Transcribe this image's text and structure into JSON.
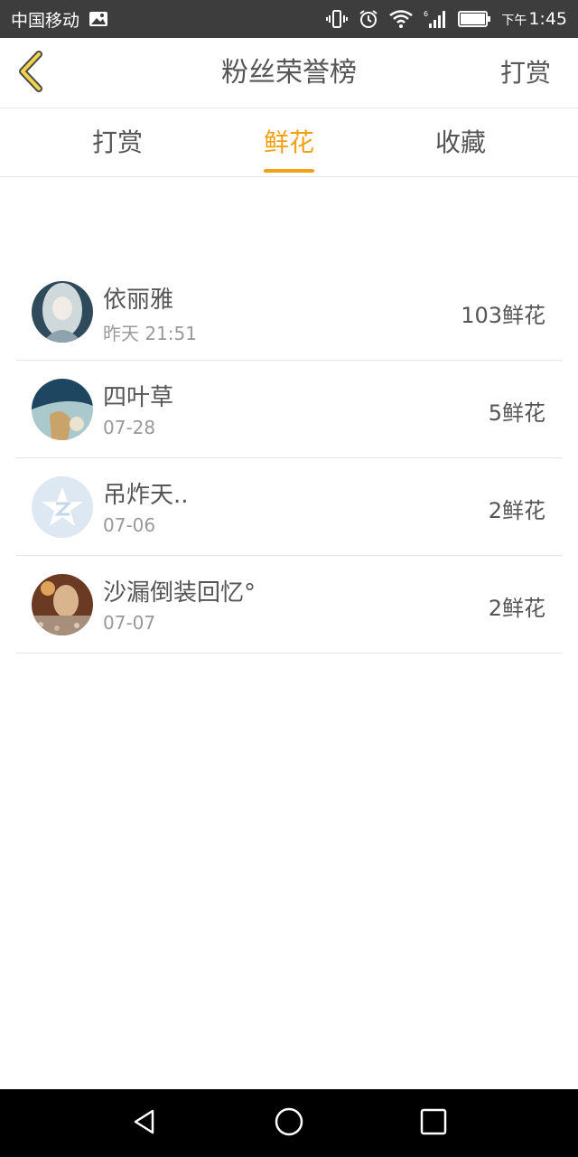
{
  "status_bar": {
    "carrier": "中国移动",
    "time_prefix": "下午",
    "time": "1:45",
    "icons": [
      "image-icon",
      "vibrate-icon",
      "alarm-icon",
      "wifi-icon",
      "signal-icon",
      "battery-icon"
    ]
  },
  "header": {
    "title": "粉丝荣誉榜",
    "action_label": "打赏"
  },
  "tabs": [
    {
      "label": "打赏",
      "active": false
    },
    {
      "label": "鲜花",
      "active": true
    },
    {
      "label": "收藏",
      "active": false
    }
  ],
  "accent_color": "#f0a114",
  "fans": [
    {
      "name": "依丽雅",
      "time": "昨天 21:51",
      "count": "103鲜花"
    },
    {
      "name": "四叶草",
      "time": "07-28",
      "count": "5鲜花"
    },
    {
      "name": "吊炸天..",
      "time": "07-06",
      "count": "2鲜花"
    },
    {
      "name": "沙漏倒装回忆°",
      "time": "07-07",
      "count": "2鲜花"
    }
  ],
  "nav_icons": [
    "back-triangle-icon",
    "home-circle-icon",
    "recent-square-icon"
  ]
}
